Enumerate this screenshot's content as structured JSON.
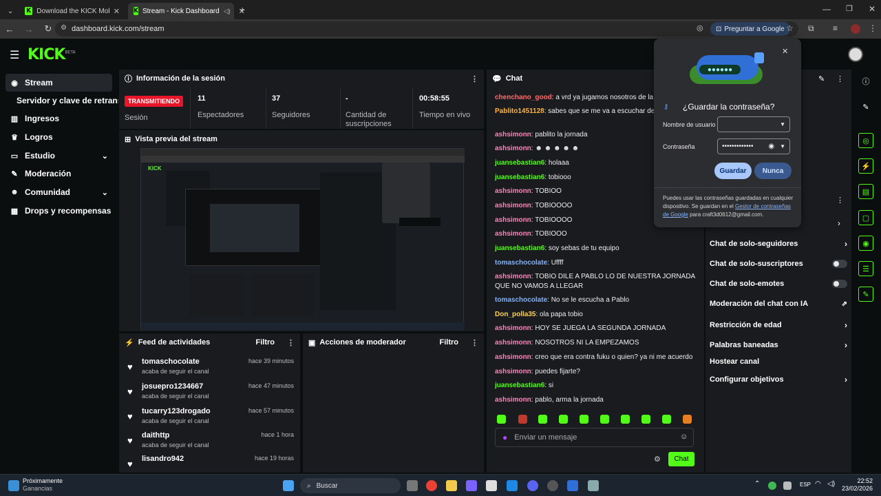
{
  "browser": {
    "tabs": [
      {
        "title": "Download the KICK Mobile & T",
        "active": false
      },
      {
        "title": "Stream - Kick Dashboard",
        "active": true
      }
    ],
    "url": "dashboard.kick.com/stream",
    "ask_google": "Preguntar a Google"
  },
  "header": {
    "logo": "KICK",
    "logo_badge": "BETA"
  },
  "sidebar": {
    "items": [
      {
        "label": "Stream",
        "icon": "play-icon",
        "selected": true
      },
      {
        "label": "Servidor y clave de retransm",
        "icon": "",
        "selected": false
      },
      {
        "label": "Ingresos",
        "icon": "chart-icon",
        "selected": false
      },
      {
        "label": "Logros",
        "icon": "trophy-icon",
        "selected": false
      },
      {
        "label": "Estudio",
        "icon": "tv-icon",
        "selected": false,
        "expandable": true
      },
      {
        "label": "Moderación",
        "icon": "wrench-icon",
        "selected": false
      },
      {
        "label": "Comunidad",
        "icon": "people-icon",
        "selected": false,
        "expandable": true
      },
      {
        "label": "Drops y recompensas",
        "icon": "grid-icon",
        "selected": false
      }
    ]
  },
  "session": {
    "title": "Información de la sesión",
    "status_badge": "TRANSMITIENDO",
    "status_label": "Sesión",
    "stats": [
      {
        "value": "11",
        "label": "Espectadores"
      },
      {
        "value": "37",
        "label": "Seguidores"
      },
      {
        "value": "-",
        "label": "Cantidad de suscripciones"
      },
      {
        "value": "00:58:55",
        "label": "Tiempo en vivo"
      }
    ]
  },
  "preview": {
    "title": "Vista previa del stream"
  },
  "activity_feed": {
    "title": "Feed de actividades",
    "filter": "Filtro",
    "items": [
      {
        "user": "tomaschocolate",
        "action": "acaba de seguir el canal",
        "time": "hace 39 minutos"
      },
      {
        "user": "josuepro1234667",
        "action": "acaba de seguir el canal",
        "time": "hace 47 minutos"
      },
      {
        "user": "tucarry123drogado",
        "action": "acaba de seguir el canal",
        "time": "hace 57 minutos"
      },
      {
        "user": "daithttp",
        "action": "acaba de seguir el canal",
        "time": "hace 1 hora"
      },
      {
        "user": "lisandro942",
        "action": "",
        "time": "hace 19 horas"
      }
    ]
  },
  "mod_actions": {
    "title": "Acciones de moderador",
    "filter": "Filtro"
  },
  "chat": {
    "title": "Chat",
    "messages": [
      {
        "user": "chenchano_good",
        "color": "#ff6b6b",
        "text": "a vrd ya jugamos nosotros de la liga t"
      },
      {
        "user": "Pablito1451128",
        "color": "#ffb347",
        "text": "sabes que se me va a escuchar demasi creo"
      },
      {
        "user": "ashsimonn",
        "color": "#f08ab8",
        "text": "pablito la jornada"
      },
      {
        "user": "ashsimonn",
        "color": "#f08ab8",
        "text": "☻ ☻ ☻ ☻ ☻"
      },
      {
        "user": "juansebastian6",
        "color": "#53fc18",
        "text": "holaaa"
      },
      {
        "user": "juansebastian6",
        "color": "#53fc18",
        "text": "tobiooo"
      },
      {
        "user": "ashsimonn",
        "color": "#f08ab8",
        "text": "TOBIOO"
      },
      {
        "user": "ashsimonn",
        "color": "#f08ab8",
        "text": "TOBIOOOO"
      },
      {
        "user": "ashsimonn",
        "color": "#f08ab8",
        "text": "TOBIOOOO"
      },
      {
        "user": "ashsimonn",
        "color": "#f08ab8",
        "text": "TOBIOOO"
      },
      {
        "user": "juansebastian6",
        "color": "#53fc18",
        "text": "soy sebas de tu equipo"
      },
      {
        "user": "tomaschocolate",
        "color": "#7fb2ff",
        "text": "Uffff"
      },
      {
        "user": "ashsimonn",
        "color": "#f08ab8",
        "text": "TOBIO DILE A PABLO LO DE NUESTRA JORNADA QUE NO VAMOS A LLEGAR"
      },
      {
        "user": "tomaschocolate",
        "color": "#7fb2ff",
        "text": "No se le escucha a Pablo"
      },
      {
        "user": "Don_polla35",
        "color": "#ffd24d",
        "text": "ola papa tobio"
      },
      {
        "user": "ashsimonn",
        "color": "#f08ab8",
        "text": "HOY SE JUEGA LA SEGUNDA JORNADA"
      },
      {
        "user": "ashsimonn",
        "color": "#f08ab8",
        "text": "NOSOTROS NI LA EMPEZAMOS"
      },
      {
        "user": "ashsimonn",
        "color": "#f08ab8",
        "text": "creo que era contra fuku o quien? ya ni me acuerdo"
      },
      {
        "user": "ashsimonn",
        "color": "#f08ab8",
        "text": "puedes fijarte?"
      },
      {
        "user": "juansebastian6",
        "color": "#53fc18",
        "text": "si"
      },
      {
        "user": "ashsimonn",
        "color": "#f08ab8",
        "text": "pablo, arma la jornada"
      }
    ],
    "input_placeholder": "Enviar un mensaje",
    "send_label": "Chat"
  },
  "chat_settings": {
    "items": [
      {
        "label": "Chat de solo-seguidores",
        "control": "chevron"
      },
      {
        "label": "Chat de solo-suscriptores",
        "control": "toggle"
      },
      {
        "label": "Chat de solo-emotes",
        "control": "toggle"
      },
      {
        "label": "Moderación del chat con IA",
        "control": "external"
      },
      {
        "label": "Restricción de edad",
        "control": "chevron"
      },
      {
        "label": "Palabras baneadas",
        "control": "chevron"
      },
      {
        "label": "Hostear canal",
        "control": "none"
      },
      {
        "label": "Configurar objetivos",
        "control": "chevron"
      }
    ]
  },
  "password_popup": {
    "title": "¿Guardar la contraseña?",
    "username_label": "Nombre de usuario",
    "username_value": "",
    "password_label": "Contraseña",
    "password_value": "•••••••••••••",
    "save_label": "Guardar",
    "never_label": "Nunca",
    "footer_text_1": "Puedes usar las contraseñas guardadas en cualquier dispositivo. Se guardan en el ",
    "footer_link": "Gestor de contraseñas de Google",
    "footer_text_2": " para craft3d0612@gmail.com."
  },
  "taskbar": {
    "widget_line1": "Próximamente",
    "widget_line2": "Ganancias",
    "search": "Buscar",
    "lang": "ESP",
    "time": "22:52",
    "date": "23/02/2026"
  },
  "colors": {
    "accent": "#53fc18",
    "live": "#e9162a",
    "panel": "#191b1f"
  }
}
